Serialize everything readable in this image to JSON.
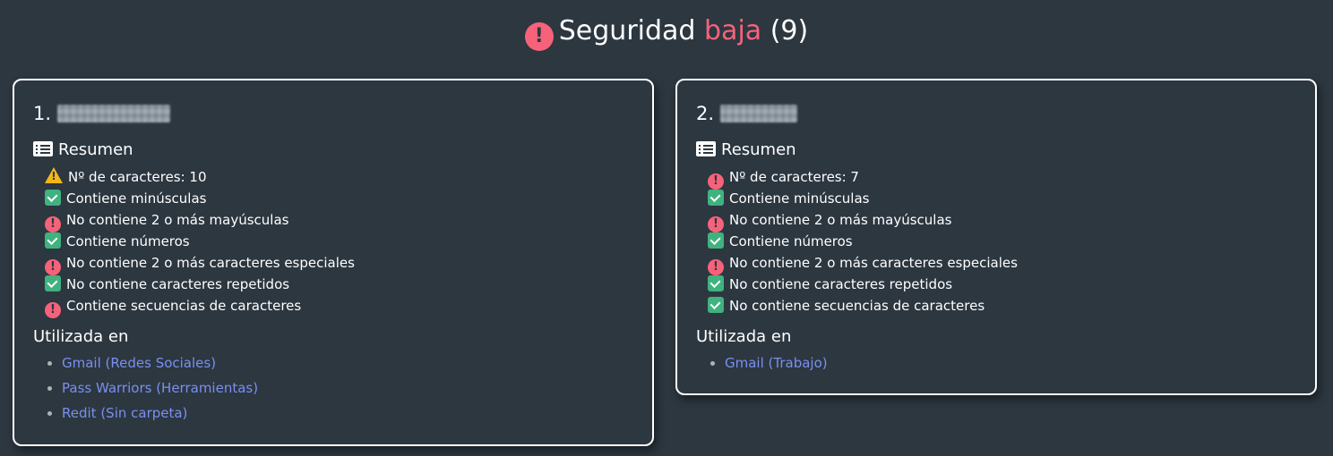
{
  "header": {
    "prefix": "Seguridad",
    "level": "baja",
    "count": "(9)",
    "alert_glyph": "!"
  },
  "colors": {
    "background": "#2c3740",
    "danger": "#f7627b",
    "success": "#3fb27f",
    "warning": "#f5b716",
    "link": "#7b8ff0"
  },
  "cards": [
    {
      "number": "1.",
      "summary_label": "Resumen",
      "checks": [
        {
          "status": "warning",
          "icon": "warning-icon",
          "text": "Nº de caracteres: 10"
        },
        {
          "status": "ok",
          "icon": "check-icon",
          "text": "Contiene minúsculas"
        },
        {
          "status": "bad",
          "icon": "alert-icon",
          "text": "No contiene 2 o más mayúsculas"
        },
        {
          "status": "ok",
          "icon": "check-icon",
          "text": "Contiene números"
        },
        {
          "status": "bad",
          "icon": "alert-icon",
          "text": "No contiene 2 o más caracteres especiales"
        },
        {
          "status": "ok",
          "icon": "check-icon",
          "text": "No contiene caracteres repetidos"
        },
        {
          "status": "bad",
          "icon": "alert-icon",
          "text": "Contiene secuencias de caracteres"
        }
      ],
      "used_label": "Utilizada en",
      "used_in": [
        "Gmail (Redes Sociales)",
        "Pass Warriors (Herramientas)",
        "Redit (Sin carpeta)"
      ]
    },
    {
      "number": "2.",
      "summary_label": "Resumen",
      "checks": [
        {
          "status": "bad",
          "icon": "alert-icon",
          "text": "Nº de caracteres: 7"
        },
        {
          "status": "ok",
          "icon": "check-icon",
          "text": "Contiene minúsculas"
        },
        {
          "status": "bad",
          "icon": "alert-icon",
          "text": "No contiene 2 o más mayúsculas"
        },
        {
          "status": "ok",
          "icon": "check-icon",
          "text": "Contiene números"
        },
        {
          "status": "bad",
          "icon": "alert-icon",
          "text": "No contiene 2 o más caracteres especiales"
        },
        {
          "status": "ok",
          "icon": "check-icon",
          "text": "No contiene caracteres repetidos"
        },
        {
          "status": "ok",
          "icon": "check-icon",
          "text": "No contiene secuencias de caracteres"
        }
      ],
      "used_label": "Utilizada en",
      "used_in": [
        "Gmail (Trabajo)"
      ]
    }
  ]
}
